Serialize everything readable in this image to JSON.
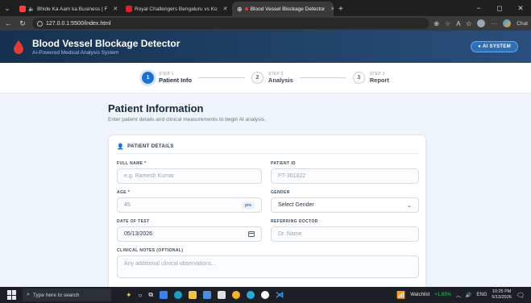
{
  "browser": {
    "tabs": [
      {
        "title": "Bhide Ka Aam ka Business | F",
        "favicon_color": "#ff3b3b",
        "active": false
      },
      {
        "title": "Royal Challengers Bengaluru vs Ko",
        "favicon_color": "#d8232a",
        "active": false
      },
      {
        "title": "Blood Vessel Blockage Detector",
        "favicon_color": "#9aa5b1",
        "active": true
      }
    ],
    "new_tab": "+",
    "url": "127.0.0.1:5500/index.html",
    "chat_label": "Chat",
    "win_min": "−",
    "win_max": "◻",
    "win_close": "✕"
  },
  "app": {
    "title": "Blood Vessel Blockage Detector",
    "subtitle": "AI-Powered Medical Analysis System",
    "badge": "● AI SYSTEM",
    "brand_color": "#15314f",
    "accent_color": "#1d6fd1"
  },
  "stepper": [
    {
      "num": "1",
      "small": "STEP 1",
      "label": "Patient Info",
      "active": true
    },
    {
      "num": "2",
      "small": "STEP 2",
      "label": "Analysis",
      "active": false
    },
    {
      "num": "3",
      "small": "STEP 3",
      "label": "Report",
      "active": false
    }
  ],
  "page": {
    "title": "Patient Information",
    "subtitle": "Enter patient details and clinical measurements to begin AI analysis."
  },
  "card": {
    "heading": "PATIENT DETAILS",
    "fields": {
      "full_name": {
        "label": "FULL NAME *",
        "placeholder": "e.g. Ramesh Kumar"
      },
      "patient_id": {
        "label": "PATIENT ID",
        "value": "PT-301822"
      },
      "age": {
        "label": "AGE *",
        "value": "45",
        "unit": "yrs"
      },
      "gender": {
        "label": "GENDER",
        "value": "Select Gender"
      },
      "date_of_test": {
        "label": "DATE OF TEST",
        "value": "05/13/2026"
      },
      "referring_doctor": {
        "label": "REFERRING DOCTOR",
        "placeholder": "Dr. Name"
      },
      "clinical_notes": {
        "label": "CLINICAL NOTES (OPTIONAL)",
        "placeholder": "Any additional clinical observations..."
      }
    }
  },
  "taskbar": {
    "search_placeholder": "Type here to search",
    "watchlist": "Watchlist",
    "watchlist_change": "+1.83%",
    "lang": "ENG",
    "time": "10:25 PM",
    "date": "5/13/2026"
  }
}
